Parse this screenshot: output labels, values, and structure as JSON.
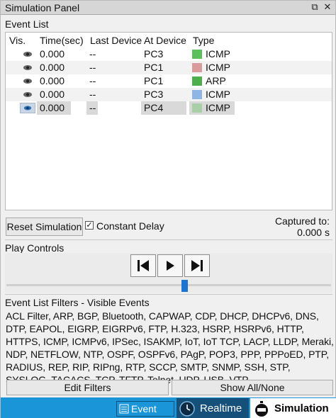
{
  "panel": {
    "title": "Simulation Panel",
    "restore_glyph": "⧉",
    "close_glyph": "✕"
  },
  "event_list": {
    "label": "Event List",
    "columns": [
      "Vis.",
      "Time(sec)",
      "Last Device",
      "At Device",
      "Type"
    ],
    "rows": [
      {
        "time": "0.000",
        "last": "--",
        "at": "PC3",
        "type": "ICMP",
        "color": "#59c05a",
        "selected": false
      },
      {
        "time": "0.000",
        "last": "--",
        "at": "PC1",
        "type": "ICMP",
        "color": "#d99b9b",
        "selected": false
      },
      {
        "time": "0.000",
        "last": "--",
        "at": "PC1",
        "type": "ARP",
        "color": "#4caf4c",
        "selected": false
      },
      {
        "time": "0.000",
        "last": "--",
        "at": "PC3",
        "type": "ICMP",
        "color": "#8fb5e4",
        "selected": false
      },
      {
        "time": "0.000",
        "last": "--",
        "at": "PC4",
        "type": "ICMP",
        "color": "#a8cfa8",
        "selected": true
      }
    ]
  },
  "controls": {
    "reset_label": "Reset Simulation",
    "constant_delay_label": "Constant Delay",
    "constant_delay_checked": true,
    "check_glyph": "✓",
    "captured_label": "Captured to:",
    "captured_value": "0.000 s"
  },
  "play_controls": {
    "label": "Play Controls",
    "slider_fraction": 0.55
  },
  "filters": {
    "label": "Event List Filters - Visible Events",
    "text": "ACL Filter, ARP, BGP, Bluetooth, CAPWAP, CDP, DHCP, DHCPv6, DNS, DTP, EAPOL, EIGRP, EIGRPv6, FTP, H.323, HSRP, HSRPv6, HTTP, HTTPS, ICMP, ICMPv6, IPSec, ISAKMP, IoT, IoT TCP, LACP, LLDP, Meraki, NDP, NETFLOW, NTP, OSPF, OSPFv6, PAgP, POP3, PPP, PPPoED, PTP, RADIUS, REP, RIP, RIPng, RTP, SCCP, SMTP, SNMP, SSH, STP, SYSLOG, TACACS, TCP, TFTP, Telnet, UDP, USB, VTP",
    "edit_label": "Edit Filters",
    "showall_label": "Show All/None"
  },
  "tabs": {
    "event_list": "Event List",
    "realtime": "Realtime",
    "simulation": "Simulation"
  },
  "colors": {
    "tab_accent": "#1a95d8",
    "slider_thumb": "#1b74cf"
  }
}
